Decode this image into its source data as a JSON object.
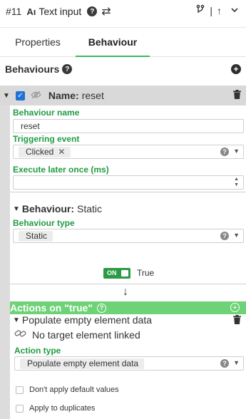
{
  "header": {
    "element_id": "#11",
    "type_icon": "text-input-icon",
    "type_glyph": "Aı",
    "title": "Text input",
    "help_icon": "question-icon",
    "swap_icon": "swap-arrows-icon",
    "right_icons": [
      "branch-icon",
      "arrow-up-icon",
      "chevron-down-icon"
    ]
  },
  "tabs": [
    {
      "label": "Properties",
      "active": false
    },
    {
      "label": "Behaviour",
      "active": true
    }
  ],
  "behaviours": {
    "title": "Behaviours",
    "item": {
      "name_label": "Name:",
      "name_value": "reset",
      "enabled": true,
      "behaviour_name_label": "Behaviour name",
      "behaviour_name_value": "reset",
      "triggering_event_label": "Triggering event",
      "triggering_event_value": "Clicked",
      "execute_later_label": "Execute later once (ms)",
      "execute_later_value": "",
      "behaviour_section_label": "Behaviour:",
      "behaviour_section_value": "Static",
      "behaviour_type_label": "Behaviour type",
      "behaviour_type_value": "Static",
      "toggle_text": "ON",
      "toggle_state_label": "True",
      "actions": {
        "title": "Actions on \"true\"",
        "action_name": "Populate empty element data",
        "target_text": "No target element linked",
        "action_type_label": "Action type",
        "action_type_value": "Populate empty element data",
        "options": [
          {
            "label": "Don't apply default values",
            "checked": false
          },
          {
            "label": "Apply to duplicates",
            "checked": false
          }
        ]
      }
    }
  },
  "colors": {
    "accent_green": "#1f9c42",
    "actions_bar_green": "#6ed276",
    "toggle_green": "#2b9a45",
    "checkbox_blue": "#1e73d8"
  }
}
